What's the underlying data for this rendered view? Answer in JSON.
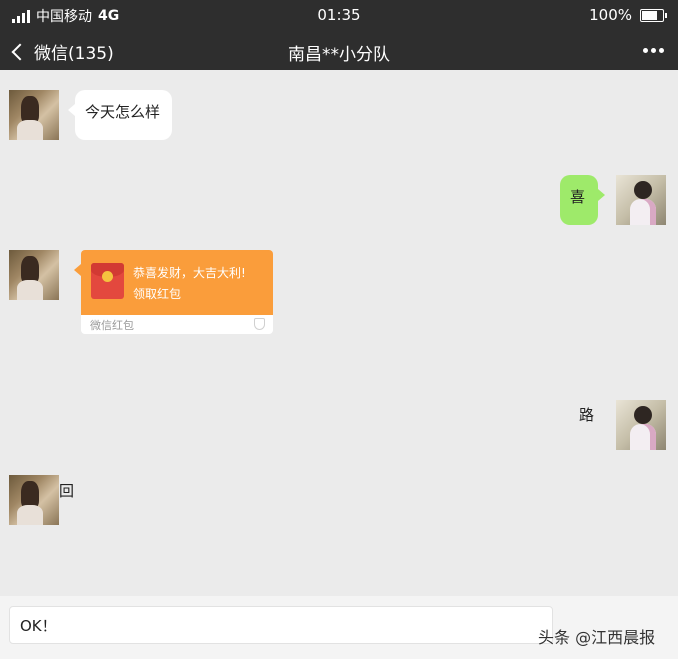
{
  "status": {
    "carrier": "中国移动",
    "network": "4G",
    "time": "01:35",
    "battery": "100%"
  },
  "nav": {
    "back_label": "微信(135)",
    "title": "南昌**小分队"
  },
  "messages": [
    {
      "side": "left",
      "avatar": "girl-avatar",
      "text": "今天怎么样"
    },
    {
      "side": "right",
      "avatar": "girl-avatar-2",
      "text": "喜"
    },
    {
      "side": "left",
      "avatar": "girl-avatar",
      "type": "red-packet"
    },
    {
      "side": "right",
      "avatar": "girl-avatar-2",
      "text": "路"
    },
    {
      "side": "left",
      "avatar": "girl-avatar",
      "text": "回"
    }
  ],
  "red_packet": {
    "title": "恭喜发财，大吉大利!",
    "subtitle": "领取红包",
    "label": "微信红包"
  },
  "input": {
    "value": "OK！"
  },
  "watermark": "头条 @江西晨报",
  "colors": {
    "header": "#2e2e2e",
    "chat_bg": "#ebebeb",
    "green_bubble": "#9eea6a",
    "red_packet": "#fa9d3b"
  }
}
